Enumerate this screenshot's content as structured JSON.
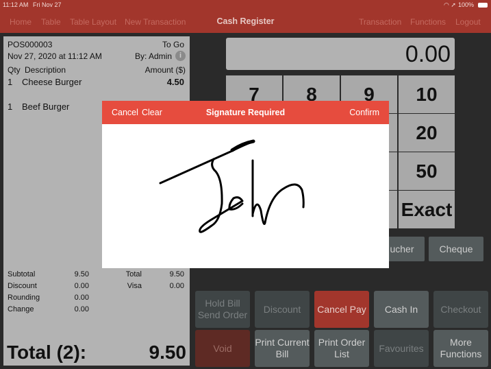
{
  "status_bar": {
    "time": "11:12 AM",
    "date": "Fri Nov 27",
    "battery": "100%",
    "icons": [
      "wifi-icon",
      "location-icon",
      "battery-icon"
    ]
  },
  "nav": {
    "left": [
      "Home",
      "Table",
      "Table Layout",
      "New Transaction"
    ],
    "title": "Cash Register",
    "right": [
      "Transaction",
      "Functions",
      "Logout"
    ]
  },
  "receipt": {
    "number": "POS000003",
    "type": "To Go",
    "datetime": "Nov 27, 2020 at 11:12 AM",
    "by": "By: Admin",
    "headers": {
      "qty": "Qty",
      "desc": "Description",
      "amount": "Amount ($)"
    },
    "items": [
      {
        "qty": "1",
        "desc": "Cheese Burger",
        "amount": "4.50"
      },
      {
        "qty": "1",
        "desc": "Beef Burger",
        "amount": ""
      }
    ],
    "summary_left": [
      {
        "label": "Subtotal",
        "value": "9.50"
      },
      {
        "label": "Discount",
        "value": "0.00"
      },
      {
        "label": "Rounding",
        "value": "0.00"
      },
      {
        "label": "Change",
        "value": "0.00"
      }
    ],
    "summary_right": [
      {
        "label": "Total",
        "value": "9.50"
      },
      {
        "label": "Visa",
        "value": "0.00"
      }
    ],
    "total_label": "Total (2):",
    "total_value": "9.50"
  },
  "display": "0.00",
  "keys": [
    "7",
    "8",
    "9",
    "10",
    "20",
    "50",
    "Exact"
  ],
  "payment_buttons": [
    "ucher",
    "Cheque"
  ],
  "functions": [
    {
      "label": "Hold Bill Send Order",
      "state": "disabled"
    },
    {
      "label": "Discount",
      "state": "disabled"
    },
    {
      "label": "Cancel Pay",
      "state": "active"
    },
    {
      "label": "Cash In",
      "state": "enabled"
    },
    {
      "label": "Checkout",
      "state": "disabled"
    },
    {
      "label": "Void",
      "state": "void"
    },
    {
      "label": "Print Current Bill",
      "state": "enabled"
    },
    {
      "label": "Print Order List",
      "state": "enabled"
    },
    {
      "label": "Favourites",
      "state": "disabled"
    },
    {
      "label": "More Functions",
      "state": "enabled"
    }
  ],
  "modal": {
    "cancel": "Cancel",
    "clear": "Clear",
    "title": "Signature Required",
    "confirm": "Confirm",
    "signature": "John"
  },
  "colors": {
    "nav": "#a2362c",
    "modal_header": "#e64c3e",
    "cancel_pay": "#a2362c",
    "void": "#5e2a24"
  }
}
